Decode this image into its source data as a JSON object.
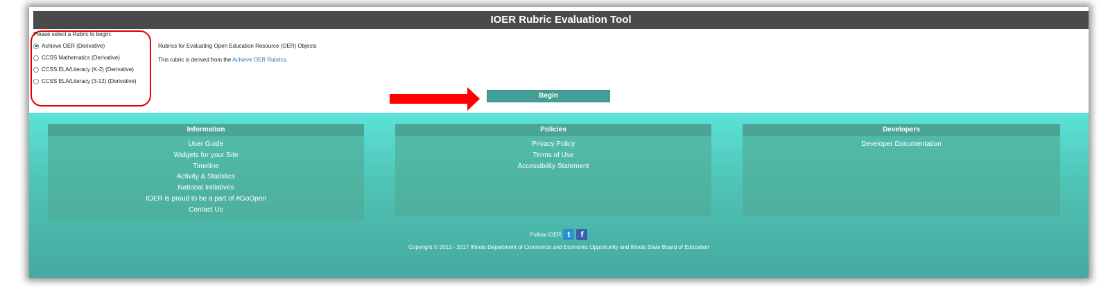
{
  "title": "IOER Rubric Evaluation Tool",
  "rubric": {
    "prompt": "Please select a Rubric to begin:",
    "options": [
      {
        "label": "Achieve OER (Derivative)",
        "selected": true
      },
      {
        "label": "CCSS Mathematics (Derivative)",
        "selected": false
      },
      {
        "label": "CCSS ELA/Literacy (K-2) (Derivative)",
        "selected": false
      },
      {
        "label": "CCSS ELA/Literacy (3-12) (Derivative)",
        "selected": false
      }
    ],
    "description": "Rubrics for Evaluating Open Education Resource (OER) Objects",
    "derived_prefix": "This rubric is derived from the",
    "derived_link": "Achieve OER Rubrics",
    "derived_suffix": "."
  },
  "begin_label": "Begin",
  "colors": {
    "titlebar": "#4a4a4a",
    "accent": "#459e95",
    "highlight": "#e00000",
    "arrow": "#ff0000"
  },
  "footer": {
    "information": {
      "heading": "Information",
      "links": [
        "User Guide",
        "Widgets for your Site",
        "Timeline",
        "Activity & Statistics",
        "National Initiatives",
        "IOER is proud to be a part of #GoOpen",
        "Contact Us"
      ]
    },
    "policies": {
      "heading": "Policies",
      "links": [
        "Privacy Policy",
        "Terms of Use",
        "Accessibility Statement"
      ]
    },
    "developers": {
      "heading": "Developers",
      "links": [
        "Developer Documentation"
      ]
    },
    "follow_label": "Follow IOER",
    "twitter_icon": "twitter-icon",
    "facebook_icon": "facebook-icon",
    "copyright": "Copyright © 2012 - 2017 Illinois Department of Commerce and Economic Opportunity and Illinois State Board of Education"
  }
}
